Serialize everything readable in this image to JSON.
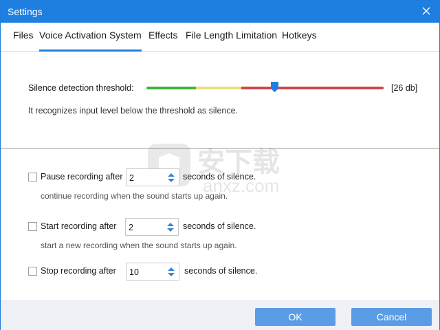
{
  "window": {
    "title": "Settings"
  },
  "tabs": [
    {
      "label": "Files",
      "active": false
    },
    {
      "label": "Voice Activation System",
      "active": true
    },
    {
      "label": "Effects",
      "active": false
    },
    {
      "label": "File Length Limitation",
      "active": false
    },
    {
      "label": "Hotkeys",
      "active": false
    }
  ],
  "threshold": {
    "label": "Silence detection threshold:",
    "value_text": "[26 db]",
    "slider_fraction": 0.54,
    "hint": "It recognizes input level below the threshold as silence.",
    "colors": {
      "green": "#3cb43c",
      "yellow": "#e8e07a",
      "red": "#d2454a",
      "thumb": "#1e7fe0"
    }
  },
  "options": {
    "pause": {
      "label": "Pause recording after",
      "value": "2",
      "suffix": "seconds of silence.",
      "hint": "continue recording when the sound starts up again.",
      "checked": false
    },
    "start": {
      "label": "Start recording after",
      "value": "2",
      "suffix": "seconds of silence.",
      "hint": "start a new recording when the sound starts up again.",
      "checked": false
    },
    "stop": {
      "label": "Stop recording after",
      "value": "10",
      "suffix": "seconds of silence.",
      "checked": false
    }
  },
  "buttons": {
    "ok": "OK",
    "cancel": "Cancel"
  },
  "watermark": {
    "text_cn": "安下载",
    "text_en": "anxz.com"
  },
  "icons": {
    "close": "close-icon",
    "spin": "spin-arrows-icon",
    "watermark_logo": "shield-bag-icon"
  },
  "accent_color": "#1e7fe0"
}
